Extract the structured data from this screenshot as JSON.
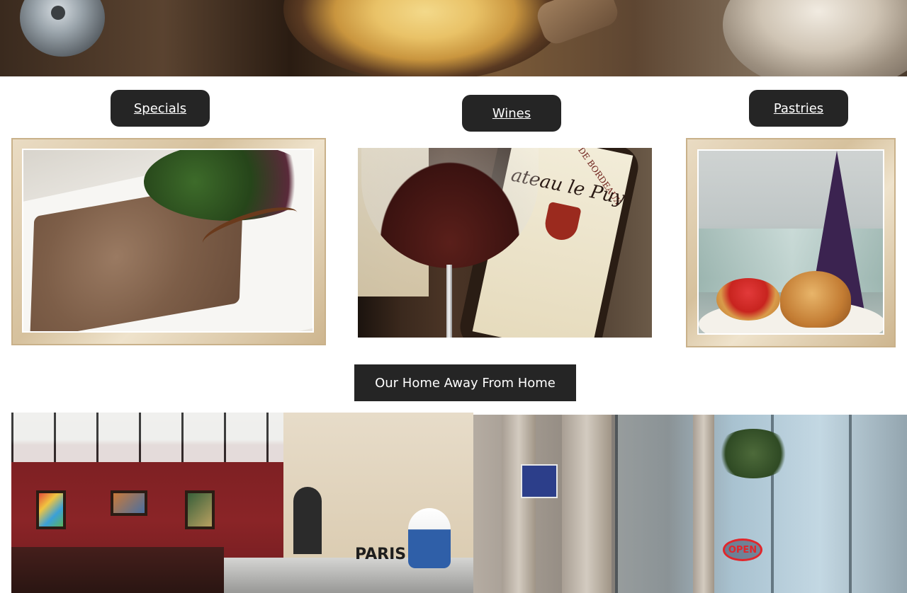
{
  "nav_buttons": {
    "specials": "Specials",
    "wines": "Wines",
    "pastries": "Pastries"
  },
  "home_banner": "Our Home Away From Home",
  "photo_text": {
    "wine_label_title": "ateau le Puy",
    "wine_label_top": "VIN FIN DE BORDEAUX",
    "paris_sign": "PARIS",
    "open_sign": "OPEN"
  },
  "colors": {
    "button_bg": "#252525",
    "button_text": "#ffffff",
    "frame": "#d6c19d"
  }
}
